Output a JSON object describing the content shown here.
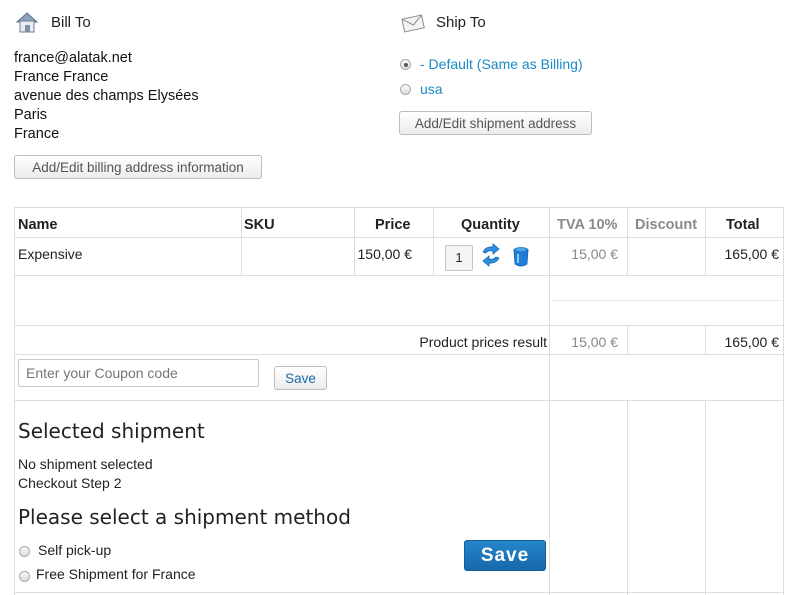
{
  "bill_to": {
    "title": "Bill To",
    "icon": "house-icon",
    "lines": [
      "france@alatak.net",
      "France France",
      "avenue des champs Elysées",
      "Paris",
      "France"
    ],
    "edit_button": "Add/Edit billing address information"
  },
  "ship_to": {
    "title": "Ship To",
    "icon": "envelope-icon",
    "options": [
      {
        "label": "- Default (Same as Billing)",
        "selected": true
      },
      {
        "label": "usa",
        "selected": false
      }
    ],
    "edit_button": "Add/Edit shipment address"
  },
  "cart": {
    "headers": {
      "name": "Name",
      "sku": "SKU",
      "price": "Price",
      "quantity": "Quantity",
      "tax": "TVA 10%",
      "discount": "Discount",
      "total": "Total"
    },
    "rows": [
      {
        "name": "Expensive",
        "sku": "",
        "price": "150,00 €",
        "quantity": "1",
        "tax": "15,00 €",
        "discount": "",
        "total": "165,00 €"
      }
    ],
    "result": {
      "label": "Product prices result",
      "tax": "15,00 €",
      "total": "165,00 €"
    }
  },
  "coupon": {
    "placeholder": "Enter your Coupon code",
    "button": "Save"
  },
  "shipment": {
    "heading": "Selected shipment",
    "status": "No shipment selected",
    "step": "Checkout Step 2",
    "method_heading": "Please select a shipment method",
    "methods": [
      {
        "label": "Self pick-up",
        "selected": false
      },
      {
        "label": "Free Shipment for France",
        "selected": false
      }
    ],
    "save_button": "Save"
  },
  "colors": {
    "link": "#1a8bc5",
    "save_button": "#1a73b8"
  }
}
